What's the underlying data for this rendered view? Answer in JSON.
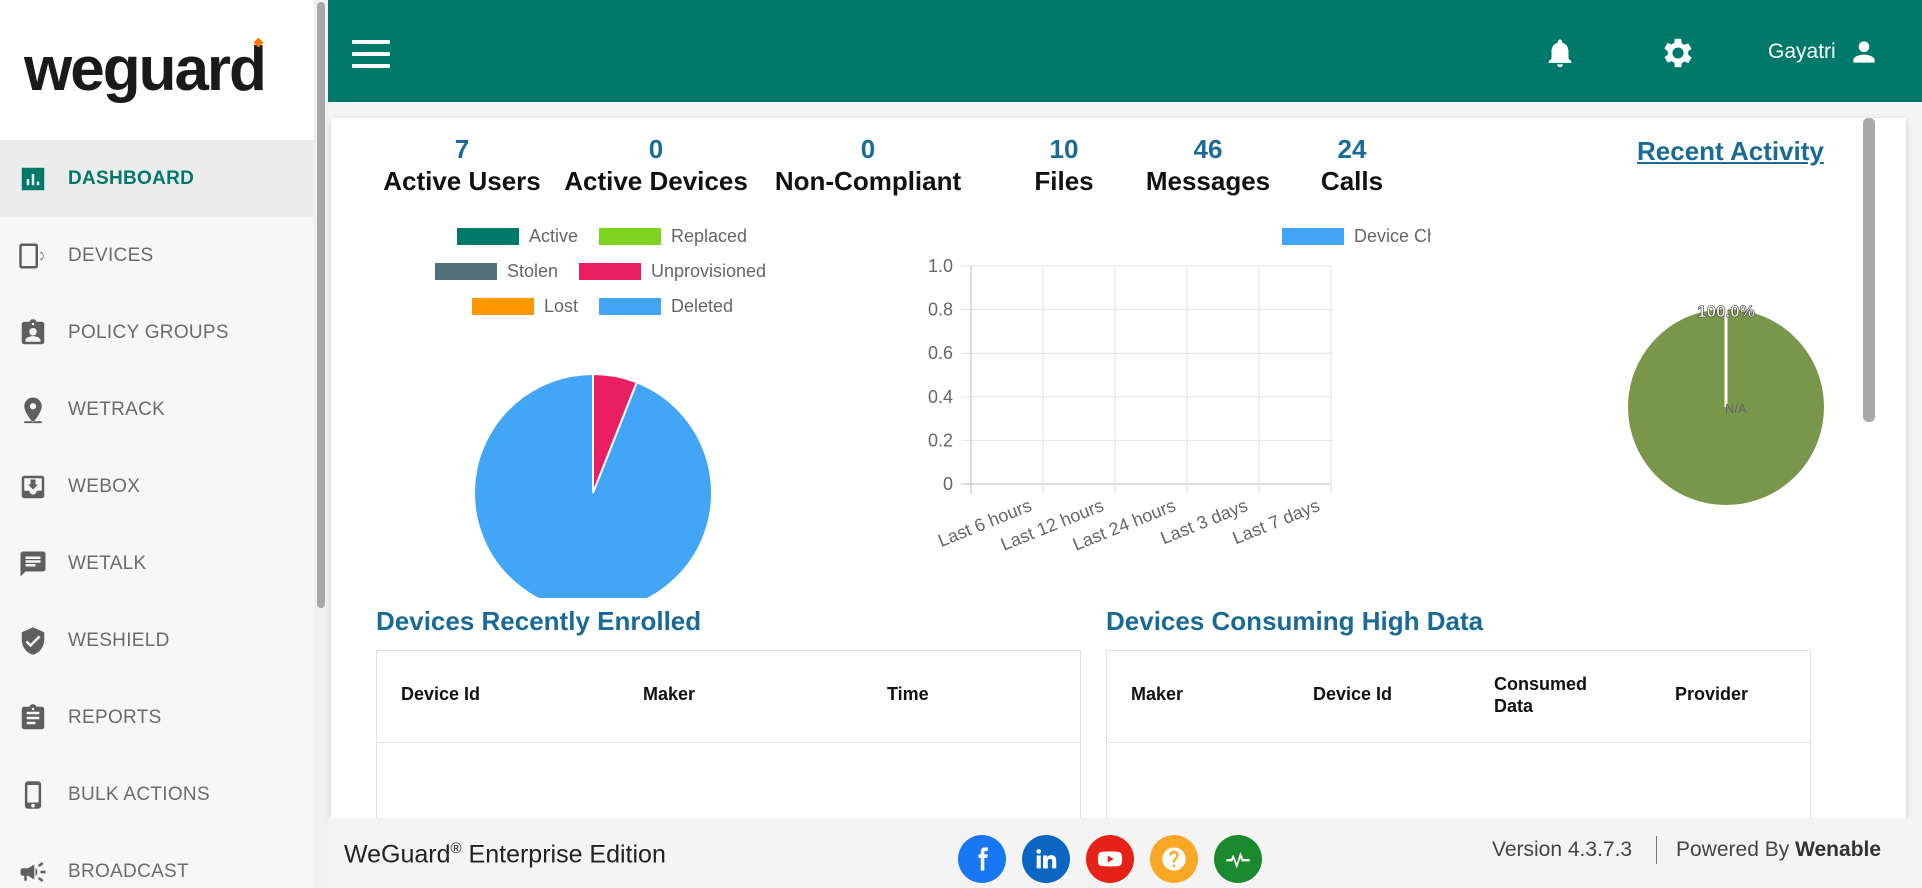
{
  "logo": {
    "text": "weguard"
  },
  "sidebar": {
    "items": [
      {
        "label": "DASHBOARD",
        "icon": "dashboard-icon",
        "active": true
      },
      {
        "label": "DEVICES",
        "icon": "device-icon",
        "active": false
      },
      {
        "label": "POLICY GROUPS",
        "icon": "policy-icon",
        "active": false
      },
      {
        "label": "WETRACK",
        "icon": "location-pin-icon",
        "active": false
      },
      {
        "label": "WEBOX",
        "icon": "download-box-icon",
        "active": false
      },
      {
        "label": "WETALK",
        "icon": "chat-icon",
        "active": false
      },
      {
        "label": "WESHIELD",
        "icon": "shield-icon",
        "active": false
      },
      {
        "label": "REPORTS",
        "icon": "clipboard-icon",
        "active": false
      },
      {
        "label": "BULK ACTIONS",
        "icon": "phone-icon",
        "active": false
      },
      {
        "label": "BROADCAST",
        "icon": "megaphone-icon",
        "active": false
      }
    ]
  },
  "header": {
    "user_name": "Gayatri",
    "bg_color": "#00796b"
  },
  "stats": [
    {
      "value": "7",
      "label": "Active Users"
    },
    {
      "value": "0",
      "label": "Active Devices"
    },
    {
      "value": "0",
      "label": "Non-Compliant"
    },
    {
      "value": "10",
      "label": "Files"
    },
    {
      "value": "46",
      "label": "Messages"
    },
    {
      "value": "24",
      "label": "Calls"
    }
  ],
  "recent_activity": "Recent Activity",
  "chart_data": [
    {
      "type": "pie",
      "legend": [
        {
          "name": "Active",
          "color": "#00796b"
        },
        {
          "name": "Replaced",
          "color": "#7ed321"
        },
        {
          "name": "Stolen",
          "color": "#546e7a"
        },
        {
          "name": "Unprovisioned",
          "color": "#e91e63"
        },
        {
          "name": "Lost",
          "color": "#ff9800"
        },
        {
          "name": "Deleted",
          "color": "#42a5f5"
        }
      ],
      "slices": [
        {
          "name": "Unprovisioned",
          "value": 6,
          "color": "#e91e63"
        },
        {
          "name": "Deleted",
          "value": 94,
          "color": "#42a5f5"
        }
      ]
    },
    {
      "type": "bar",
      "legend": "Device Checkins (In %)",
      "legend_color": "#42a5f5",
      "categories": [
        "Last 6 hours",
        "Last 12 hours",
        "Last 24 hours",
        "Last 3 days",
        "Last 7 days"
      ],
      "values": [
        0,
        0,
        0,
        0,
        0
      ],
      "ylim": [
        0,
        1.0
      ],
      "yticks": [
        "1.0",
        "0.8",
        "0.6",
        "0.4",
        "0.2",
        "0"
      ]
    },
    {
      "type": "pie",
      "slices": [
        {
          "name": "N/A",
          "value": 100,
          "color": "#7a964a"
        }
      ],
      "label": "100.0%",
      "legend": "N/A"
    }
  ],
  "tables": {
    "enrolled": {
      "title": "Devices Recently Enrolled",
      "columns": [
        "Device Id",
        "Maker",
        "Time"
      ]
    },
    "high_data": {
      "title": "Devices Consuming High Data",
      "columns": [
        "Maker",
        "Device Id",
        "Consumed Data",
        "Provider"
      ]
    }
  },
  "footer": {
    "edition_brand": "WeGuard",
    "edition_reg": "®",
    "edition_text": " Enterprise Edition",
    "version": "Version 4.3.7.3",
    "powered_prefix": "Powered By ",
    "powered_brand": "Wenable",
    "socials": [
      {
        "name": "facebook-icon",
        "color": "#1877f2"
      },
      {
        "name": "linkedin-icon",
        "color": "#0a66c2"
      },
      {
        "name": "youtube-icon",
        "color": "#e62117"
      },
      {
        "name": "help-icon",
        "color": "#f9a825"
      },
      {
        "name": "pulse-icon",
        "color": "#1b8a2e"
      }
    ]
  }
}
